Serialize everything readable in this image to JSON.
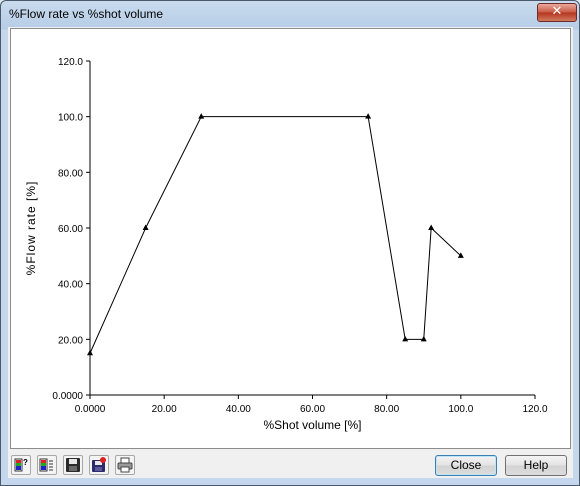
{
  "window": {
    "title": "%Flow rate vs %shot volume"
  },
  "buttons": {
    "close": "Close",
    "help": "Help"
  },
  "toolbar": [
    {
      "name": "legend-help-icon"
    },
    {
      "name": "data-view-icon"
    },
    {
      "name": "save-icon"
    },
    {
      "name": "save-as-icon"
    },
    {
      "name": "print-icon"
    }
  ],
  "chart_data": {
    "type": "line",
    "title": "",
    "xlabel": "%Shot volume [%]",
    "ylabel": "%Flow rate [%]",
    "xlim": [
      0,
      120
    ],
    "ylim": [
      0,
      120
    ],
    "x_ticks": [
      "0.0000",
      "20.00",
      "40.00",
      "60.00",
      "80.00",
      "100.0",
      "120.0"
    ],
    "y_ticks": [
      "0.0000",
      "20.00",
      "40.00",
      "60.00",
      "80.00",
      "100.0",
      "120.0"
    ],
    "grid": false,
    "series": [
      {
        "x": [
          0,
          15,
          30,
          75,
          85,
          90,
          92,
          100
        ],
        "y": [
          15,
          60,
          100,
          100,
          20,
          20,
          60,
          50
        ]
      }
    ]
  }
}
